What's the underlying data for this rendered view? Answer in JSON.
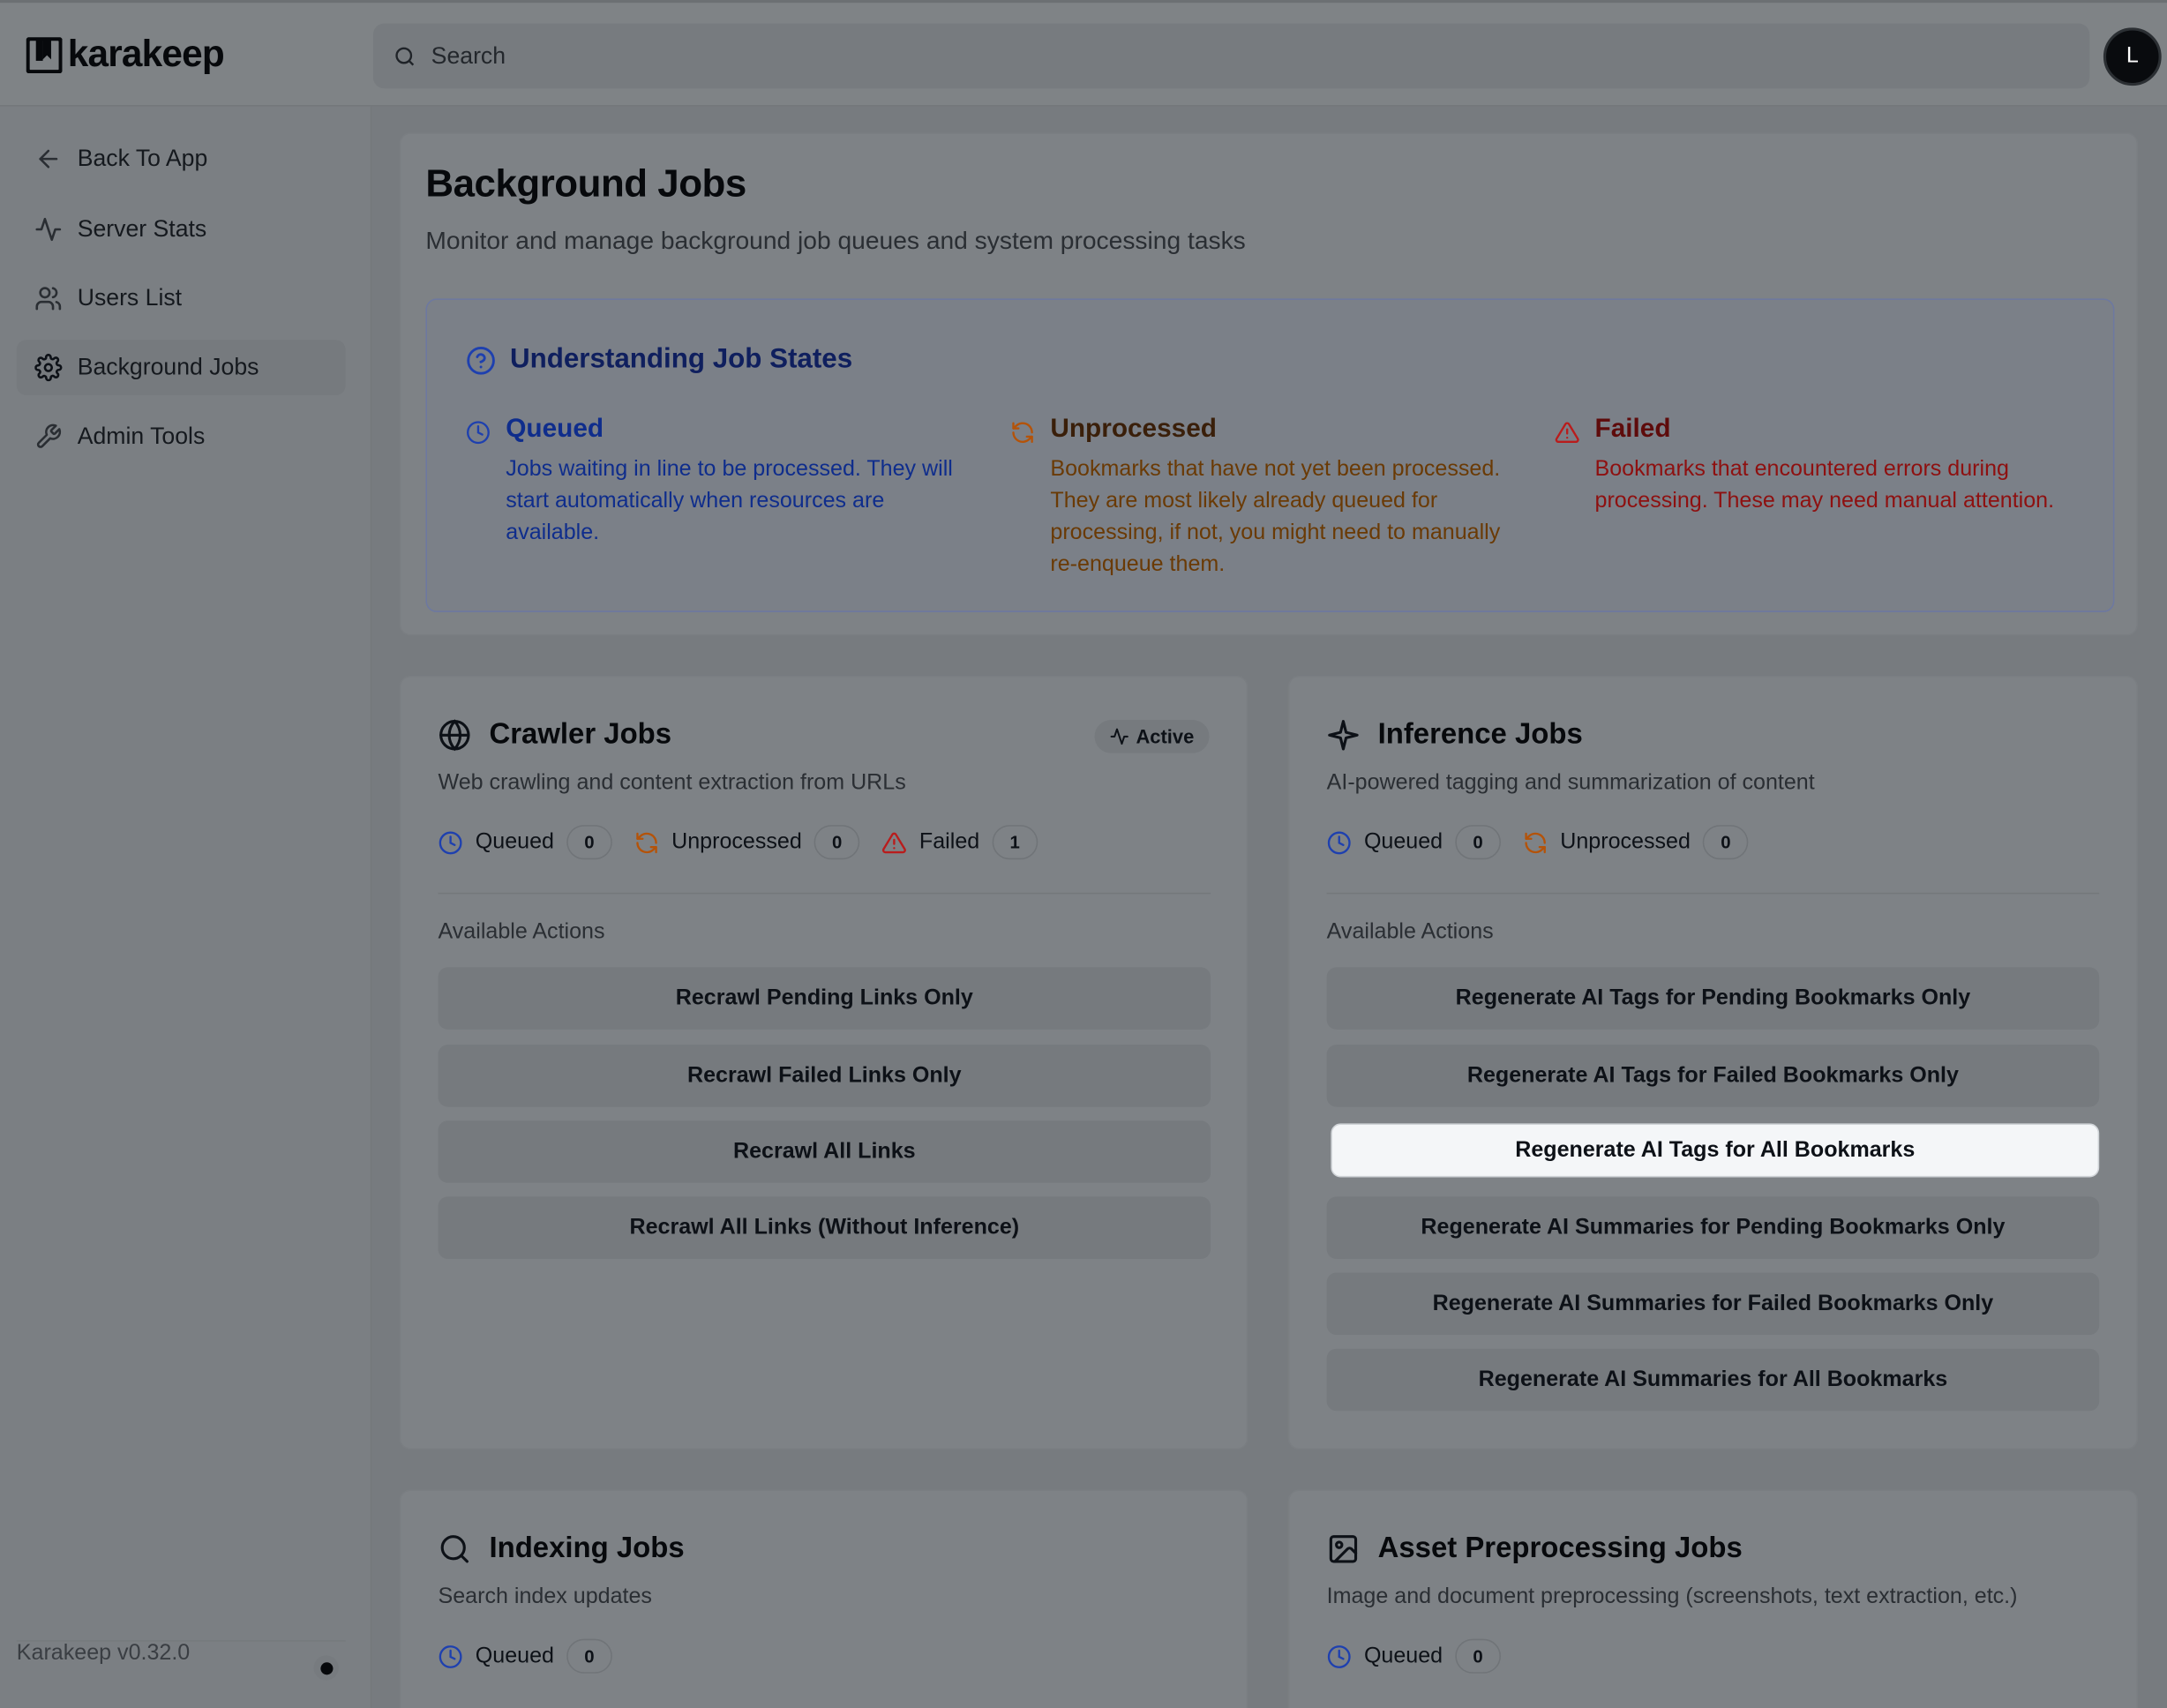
{
  "brand": {
    "name": "karakeep"
  },
  "search": {
    "placeholder": "Search"
  },
  "user": {
    "avatar_initial": "L"
  },
  "sidebar": {
    "items": [
      {
        "label": "Back To App",
        "icon": "arrow-left-icon"
      },
      {
        "label": "Server Stats",
        "icon": "activity-icon"
      },
      {
        "label": "Users List",
        "icon": "users-icon"
      },
      {
        "label": "Background Jobs",
        "icon": "gear-icon",
        "active": true
      },
      {
        "label": "Admin Tools",
        "icon": "wrench-icon"
      }
    ],
    "version": "Karakeep v0.32.0"
  },
  "header": {
    "title": "Background Jobs",
    "subtitle": "Monitor and manage background job queues and system processing tasks"
  },
  "job_states": {
    "title": "Understanding Job States",
    "queued": {
      "title": "Queued",
      "desc": "Jobs waiting in line to be processed. They will start automatically when resources are available."
    },
    "unprocessed": {
      "title": "Unprocessed",
      "desc": "Bookmarks that have not yet been processed. They are most likely already queued for processing, if not, you might need to manually re-enqueue them."
    },
    "failed": {
      "title": "Failed",
      "desc": "Bookmarks that encountered errors during processing. These may need manual attention."
    }
  },
  "crawler": {
    "title": "Crawler Jobs",
    "desc": "Web crawling and content extraction from URLs",
    "badge": "Active",
    "counts": {
      "queued_label": "Queued",
      "queued": "0",
      "unprocessed_label": "Unprocessed",
      "unprocessed": "0",
      "failed_label": "Failed",
      "failed": "1"
    },
    "actions_label": "Available Actions",
    "actions": [
      "Recrawl Pending Links Only",
      "Recrawl Failed Links Only",
      "Recrawl All Links",
      "Recrawl All Links (Without Inference)"
    ]
  },
  "inference": {
    "title": "Inference Jobs",
    "desc": "AI-powered tagging and summarization of content",
    "counts": {
      "queued_label": "Queued",
      "queued": "0",
      "unprocessed_label": "Unprocessed",
      "unprocessed": "0"
    },
    "actions_label": "Available Actions",
    "actions": [
      "Regenerate AI Tags for Pending Bookmarks Only",
      "Regenerate AI Tags for Failed Bookmarks Only",
      "Regenerate AI Tags for All Bookmarks",
      "Regenerate AI Summaries for Pending Bookmarks Only",
      "Regenerate AI Summaries for Failed Bookmarks Only",
      "Regenerate AI Summaries for All Bookmarks"
    ]
  },
  "indexing": {
    "title": "Indexing Jobs",
    "desc": "Search index updates",
    "counts": {
      "queued_label": "Queued",
      "queued": "0"
    }
  },
  "asset": {
    "title": "Asset Preprocessing Jobs",
    "desc": "Image and document preprocessing (screenshots, text extraction, etc.)",
    "counts": {
      "queued_label": "Queued",
      "queued": "0"
    }
  },
  "colors": {
    "queued": "#1e40af",
    "unprocessed": "#b45309",
    "failed": "#b91c1c",
    "highlight": "#f4f6f8"
  }
}
